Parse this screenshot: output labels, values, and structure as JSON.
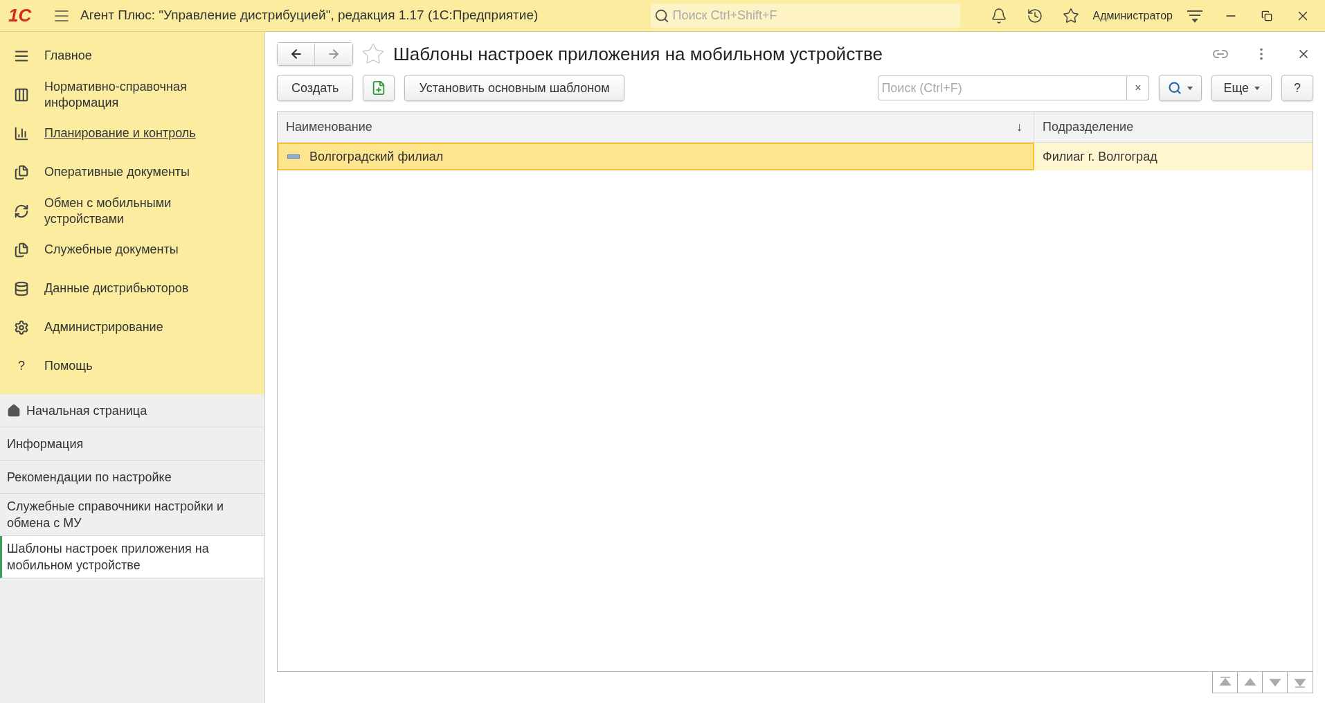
{
  "window": {
    "logo": "1С",
    "title": "Агент Плюс: \"Управление дистрибуцией\", редакция 1.17  (1С:Предприятие)",
    "search_placeholder": "Поиск Ctrl+Shift+F",
    "user": "Администратор"
  },
  "sections": [
    {
      "label": "Главное",
      "hovered": false
    },
    {
      "label": "Нормативно-справочная информация",
      "hovered": false
    },
    {
      "label": "Планирование и контроль",
      "hovered": true
    },
    {
      "label": "Оперативные документы",
      "hovered": false
    },
    {
      "label": "Обмен с мобильными устройствами",
      "hovered": false
    },
    {
      "label": "Служебные документы",
      "hovered": false
    },
    {
      "label": "Данные дистрибьюторов",
      "hovered": false
    },
    {
      "label": "Администрирование",
      "hovered": false
    },
    {
      "label": "Помощь",
      "glyph": "?",
      "hovered": false
    }
  ],
  "open_pages": [
    {
      "label": "Начальная страница",
      "selected": false
    },
    {
      "label": "Информация",
      "selected": false
    },
    {
      "label": "Рекомендации по настройке",
      "selected": false
    },
    {
      "label": "Служебные справочники настройки и обмена с МУ",
      "selected": false
    },
    {
      "label": "Шаблоны настроек приложения на мобильном устройстве",
      "selected": true
    }
  ],
  "form": {
    "title": "Шаблоны настроек приложения на мобильном устройстве",
    "toolbar": {
      "create": "Создать",
      "set_default": "Установить основным шаблоном",
      "search_placeholder": "Поиск (Ctrl+F)",
      "clear": "×",
      "more": "Еще",
      "help": "?"
    },
    "table": {
      "columns": [
        {
          "label": "Наименование",
          "sort": "↓"
        },
        {
          "label": "Подразделение"
        }
      ],
      "rows": [
        {
          "cells": [
            "Волгоградский филиал",
            "Филиаг г. Волгоград"
          ],
          "selected": true
        }
      ]
    }
  }
}
